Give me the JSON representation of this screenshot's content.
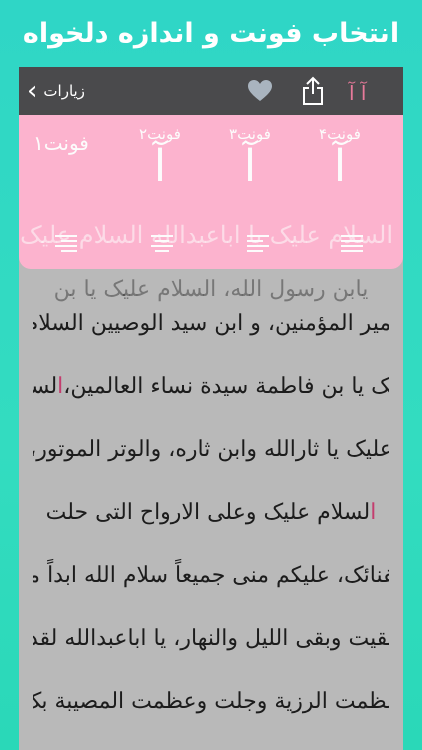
{
  "banner": {
    "title": "انتخاب فونت و اندازه دلخواه"
  },
  "navbar": {
    "back_label": "زیارات",
    "back_icon": "chevron-left-icon",
    "font_size_toggle": "آ آ",
    "heart_color": "#a9b4bf",
    "accent": "#e87a9a"
  },
  "font_panel": {
    "options": [
      {
        "label": "فونت۴",
        "sample": "آ"
      },
      {
        "label": "فونت۳",
        "sample": "آ"
      },
      {
        "label": "فونت۲",
        "sample": "آ"
      },
      {
        "label": "فونت۱",
        "sample": ""
      }
    ],
    "ghost_line": "السلام علیک یا اباعبدالله السلام علیک",
    "ghost_line2": "یابن رسول الله، السلام علیک یا بن"
  },
  "reader": {
    "lines": [
      {
        "before": "",
        "hl": "ا",
        "after": "میر المؤمنین، و ابن سید الوصیین السلام"
      },
      {
        "before": "علیک یا بن فاطمة سیدة نساء العالمین، ",
        "hl": "ا",
        "after": "لسلام"
      },
      {
        "before": "علیک یا ثارالله وابن ثاره، والوتر الموتور،",
        "hl": "",
        "after": ""
      },
      {
        "before": "",
        "hl": "ا",
        "after": "لسلام علیک وعلی الارواح التی حلت"
      },
      {
        "before": "بفنائک، علیکم منی جمیعاً سلام الله ابداً ما",
        "hl": "",
        "after": ""
      },
      {
        "before": "بقیت وبقی اللیل والنهار، یا اباعبدالله لقد",
        "hl": "",
        "after": ""
      },
      {
        "before": "عظمت الرزیة وجلت وعظمت المصیبة بک",
        "hl": "",
        "after": ""
      }
    ]
  }
}
